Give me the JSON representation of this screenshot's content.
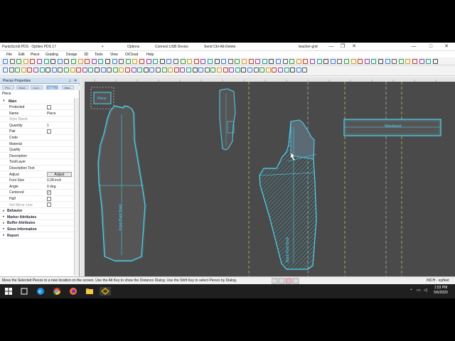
{
  "window": {
    "title": "PantsScroll.PDS - Optitex PDS 17",
    "options": "Options",
    "connect_usb": "Connect USB Device",
    "ctrl_alt_del": "Send Ctrl-Alt-Delete",
    "user": "teacher-grid"
  },
  "menu": [
    "File",
    "Edit",
    "Piece",
    "Grading",
    "Design",
    "3D",
    "Tools",
    "View",
    "O/Cloud",
    "Help"
  ],
  "panel": {
    "title": "Pieces Properties",
    "tabs": [
      "Pro..",
      "Grad..",
      "Curv..",
      "Piec..",
      "Mea.."
    ],
    "subtitle": "Piece",
    "section_main": "Main",
    "rows": [
      {
        "label": "Protected",
        "kind": "check",
        "checked": false
      },
      {
        "label": "Name",
        "kind": "text",
        "value": "Piece"
      },
      {
        "label": "Style Name",
        "kind": "dim",
        "value": ""
      },
      {
        "label": "Quantity",
        "kind": "text",
        "value": "1"
      },
      {
        "label": "Pair",
        "kind": "check",
        "checked": false
      },
      {
        "label": "Code",
        "kind": "text",
        "value": ""
      },
      {
        "label": "Material",
        "kind": "text",
        "value": ""
      },
      {
        "label": "Quality",
        "kind": "text",
        "value": ""
      },
      {
        "label": "Description",
        "kind": "text",
        "value": ""
      },
      {
        "label": "Tool/Layer",
        "kind": "text",
        "value": ""
      },
      {
        "label": "Description Text",
        "kind": "text",
        "value": ""
      },
      {
        "label": "Adjust",
        "kind": "button",
        "value": "Adjust"
      },
      {
        "label": "Font Size",
        "kind": "text",
        "value": "0.28 inch"
      },
      {
        "label": "Angle",
        "kind": "text",
        "value": "0 deg"
      },
      {
        "label": "Centered",
        "kind": "check",
        "checked": true
      },
      {
        "label": "Half",
        "kind": "check",
        "checked": false
      },
      {
        "label": "Set Mirror Line",
        "kind": "dimcheck",
        "checked": false
      }
    ],
    "groups": [
      "Behavior",
      "Marker Attributes",
      "Buffer Attributes",
      "Sizes Information",
      "Report"
    ]
  },
  "canvas_labels": {
    "piece_box": "Piece",
    "front_text": "Front Pant Shell",
    "back_text": "Back Pant Shell",
    "waistband": "Waistband"
  },
  "status": {
    "message": "Move the Selected Pieces to a new location on the screen. Use the Alt Key to show the Distance Dialog. Use the Shift Key to select Pieces by Dialog.",
    "units": "INCH - sq/feet"
  },
  "taskbar": {
    "time": "1:53 PM",
    "date": "5/6/2020"
  },
  "colors": {
    "canvas": "#4a4a4a",
    "piece_outline": "#4fd7f5",
    "grid_line": "#b8c25a",
    "panel_header": "#cfe0f3"
  }
}
